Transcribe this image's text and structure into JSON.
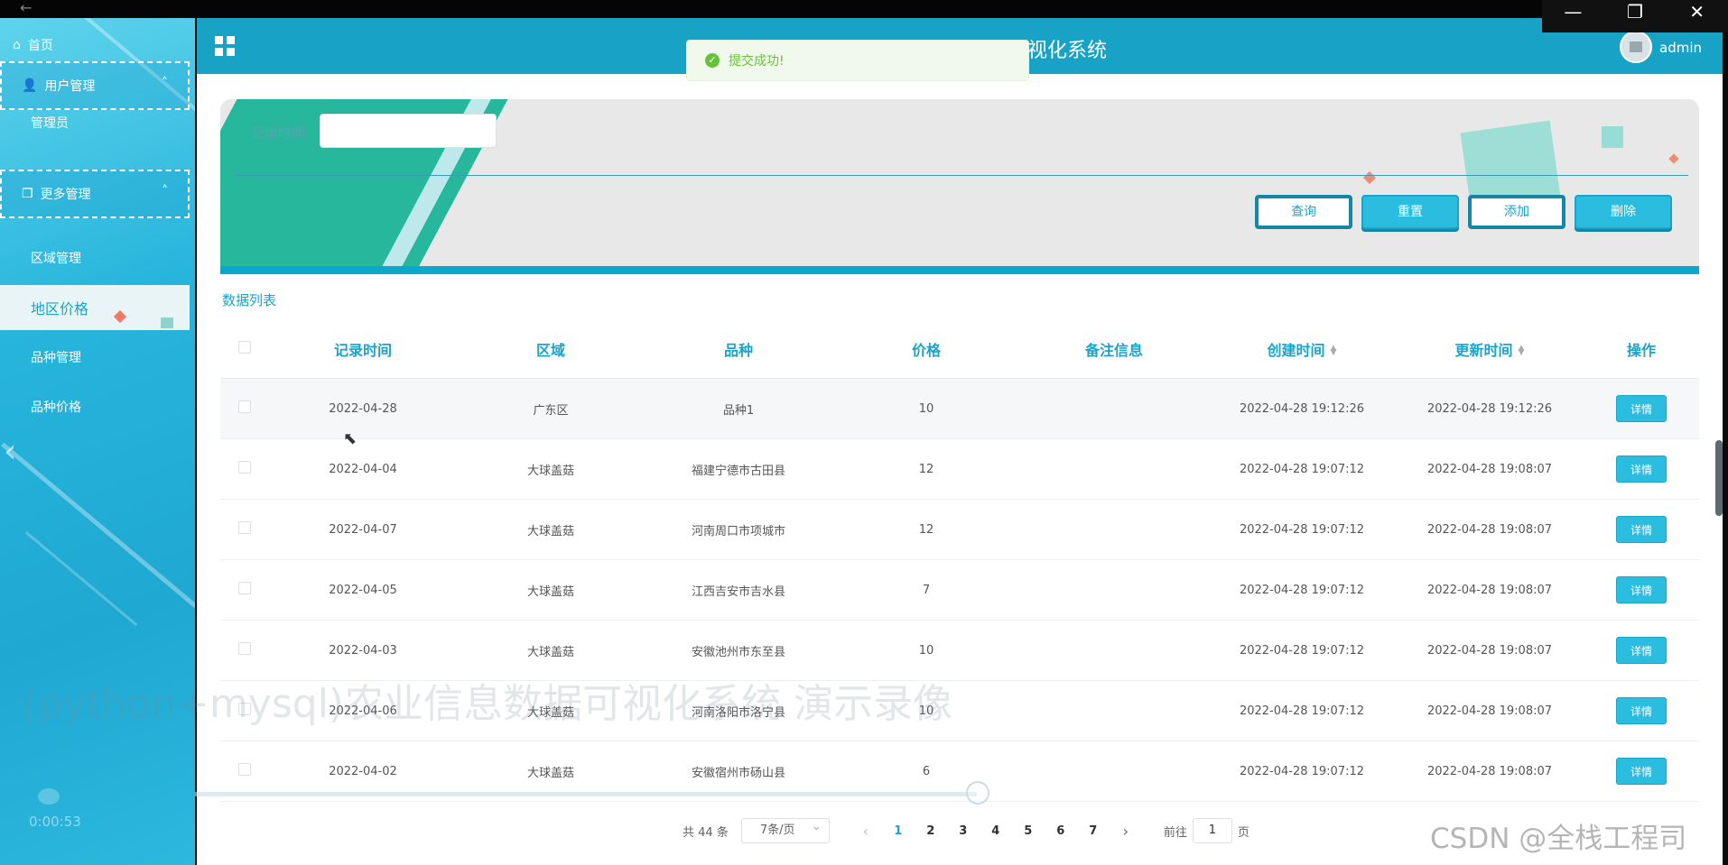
{
  "window": {
    "back_glyph": "←",
    "min": "—",
    "restore": "❐",
    "close": "✕"
  },
  "sidebar": {
    "home": "首页",
    "groups": [
      {
        "label": "用户管理",
        "items": [
          "管理员"
        ]
      },
      {
        "label": "更多管理",
        "items": [
          "区域管理",
          "地区价格",
          "品种管理",
          "品种价格"
        ]
      }
    ],
    "active_item": "地区价格",
    "video_time": "0:00:53"
  },
  "header": {
    "title": "视化系统",
    "user": "admin"
  },
  "toast": {
    "message": "提交成功!"
  },
  "search": {
    "label": "记录时间",
    "value": "",
    "buttons": {
      "query": "查询",
      "reset": "重置",
      "add": "添加",
      "delete": "删除"
    }
  },
  "list_title": "数据列表",
  "table": {
    "columns": [
      "记录时间",
      "区域",
      "品种",
      "价格",
      "备注信息",
      "创建时间",
      "更新时间",
      "操作"
    ],
    "rows": [
      {
        "date": "2022-04-28",
        "region": "广东区",
        "variety": "品种1",
        "price": "10",
        "note": "",
        "created": "2022-04-28 19:12:26",
        "updated": "2022-04-28 19:12:26",
        "action": "详情"
      },
      {
        "date": "2022-04-04",
        "region": "大球盖菇",
        "variety": "福建宁德市古田县",
        "price": "12",
        "note": "",
        "created": "2022-04-28 19:07:12",
        "updated": "2022-04-28 19:08:07",
        "action": "详情"
      },
      {
        "date": "2022-04-07",
        "region": "大球盖菇",
        "variety": "河南周口市项城市",
        "price": "12",
        "note": "",
        "created": "2022-04-28 19:07:12",
        "updated": "2022-04-28 19:08:07",
        "action": "详情"
      },
      {
        "date": "2022-04-05",
        "region": "大球盖菇",
        "variety": "江西吉安市吉水县",
        "price": "7",
        "note": "",
        "created": "2022-04-28 19:07:12",
        "updated": "2022-04-28 19:08:07",
        "action": "详情"
      },
      {
        "date": "2022-04-03",
        "region": "大球盖菇",
        "variety": "安徽池州市东至县",
        "price": "10",
        "note": "",
        "created": "2022-04-28 19:07:12",
        "updated": "2022-04-28 19:08:07",
        "action": "详情"
      },
      {
        "date": "2022-04-06",
        "region": "大球盖菇",
        "variety": "河南洛阳市洛宁县",
        "price": "10",
        "note": "",
        "created": "2022-04-28 19:07:12",
        "updated": "2022-04-28 19:08:07",
        "action": "详情"
      },
      {
        "date": "2022-04-02",
        "region": "大球盖菇",
        "variety": "安徽宿州市砀山县",
        "price": "6",
        "note": "",
        "created": "2022-04-28 19:07:12",
        "updated": "2022-04-28 19:08:07",
        "action": "详情"
      }
    ]
  },
  "pagination": {
    "total": "共 44 条",
    "page_size": "7条/页",
    "pages": [
      "1",
      "2",
      "3",
      "4",
      "5",
      "6",
      "7"
    ],
    "current": "1",
    "goto_prefix": "前往",
    "goto_value": "1",
    "goto_suffix": "页"
  },
  "overlay": {
    "watermark": "(python+mysql)农业信息数据可视化系统 演示录像",
    "csdn": "CSDN @全栈工程司"
  },
  "colors": {
    "accent": "#1aa4c8",
    "header": "#18a3c6",
    "success": "#67c23a"
  }
}
